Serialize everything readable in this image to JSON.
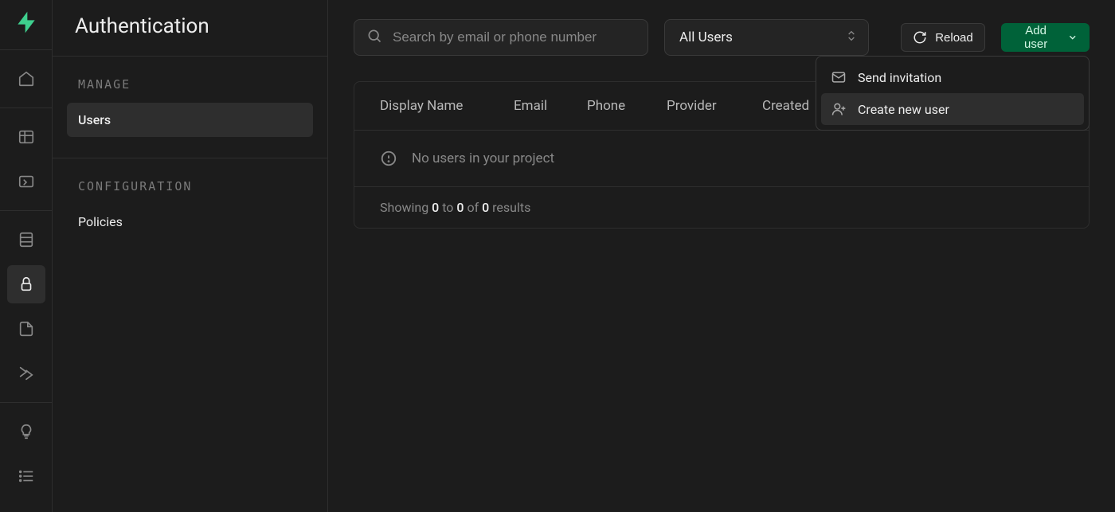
{
  "page_title": "Authentication",
  "sidebar": {
    "sections": [
      {
        "title": "MANAGE",
        "items": [
          {
            "label": "Users",
            "active": true
          }
        ]
      },
      {
        "title": "CONFIGURATION",
        "items": [
          {
            "label": "Policies",
            "active": false
          }
        ]
      }
    ]
  },
  "toolbar": {
    "search_placeholder": "Search by email or phone number",
    "filter_value": "All Users",
    "reload_label": "Reload",
    "add_user_label": "Add user"
  },
  "dropdown": {
    "send_invitation": "Send invitation",
    "create_new_user": "Create new user"
  },
  "table": {
    "columns": {
      "display_name": "Display Name",
      "email": "Email",
      "phone": "Phone",
      "provider": "Provider",
      "created": "Created"
    },
    "empty_message": "No users in your project",
    "footer": {
      "showing": "Showing",
      "from": "0",
      "to_word": "to",
      "to": "0",
      "of_word": "of",
      "total": "0",
      "results": "results"
    }
  }
}
